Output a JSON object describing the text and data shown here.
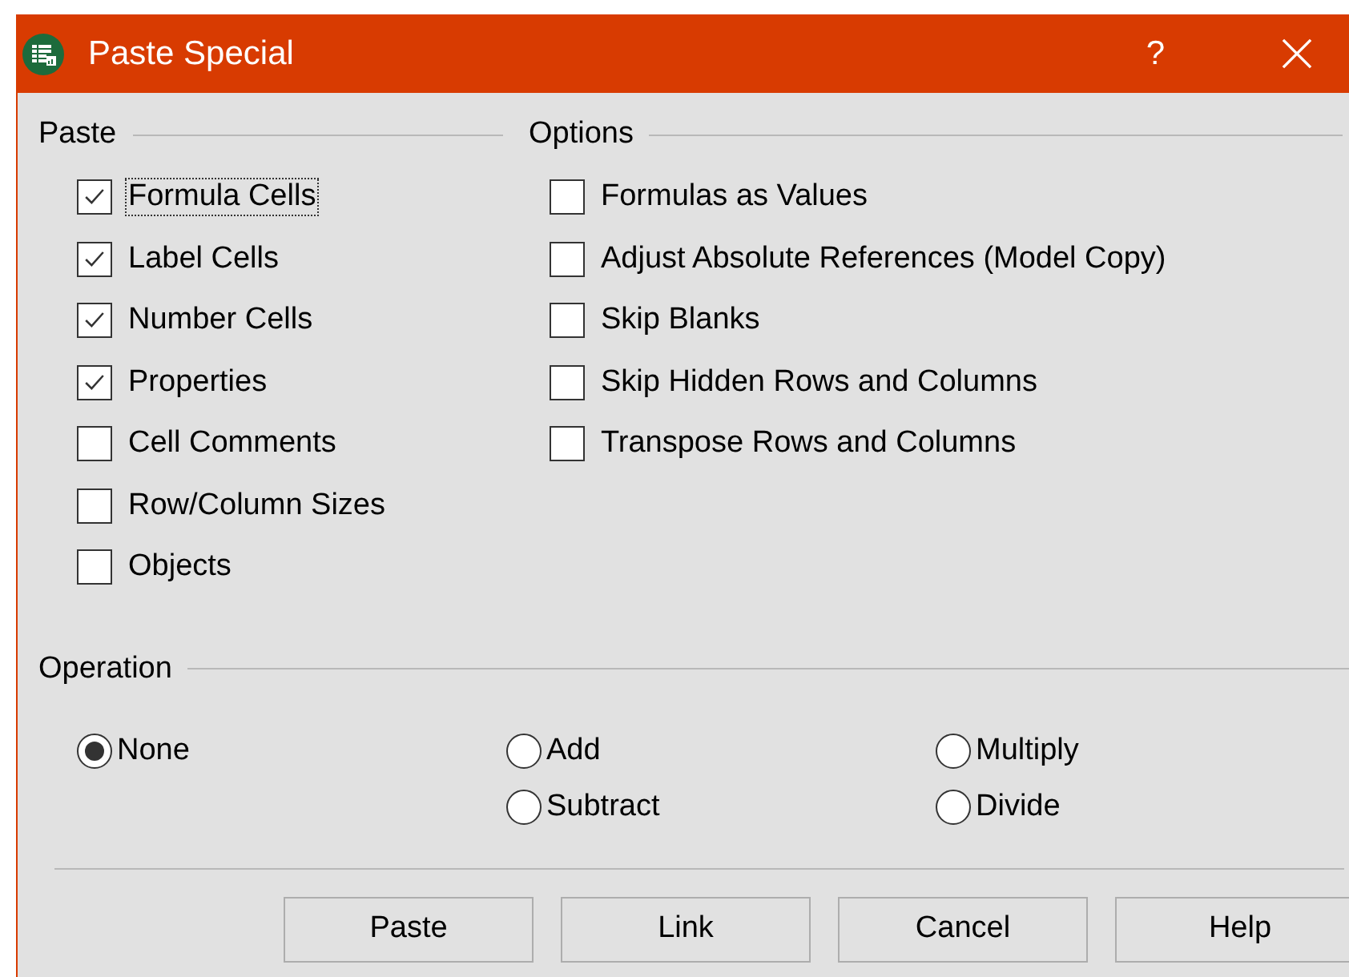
{
  "window": {
    "title": "Paste Special",
    "help": "?"
  },
  "paste": {
    "title": "Paste",
    "items": [
      {
        "label": "Formula Cells",
        "checked": true,
        "focused": true
      },
      {
        "label": "Label Cells",
        "checked": true,
        "focused": false
      },
      {
        "label": "Number Cells",
        "checked": true,
        "focused": false
      },
      {
        "label": "Properties",
        "checked": true,
        "focused": false
      },
      {
        "label": "Cell Comments",
        "checked": false,
        "focused": false
      },
      {
        "label": "Row/Column Sizes",
        "checked": false,
        "focused": false
      },
      {
        "label": "Objects",
        "checked": false,
        "focused": false
      }
    ]
  },
  "options": {
    "title": "Options",
    "items": [
      {
        "label": "Formulas as Values",
        "checked": false,
        "focused": false
      },
      {
        "label": "Adjust Absolute References (Model Copy)",
        "checked": false,
        "focused": false
      },
      {
        "label": "Skip Blanks",
        "checked": false,
        "focused": false
      },
      {
        "label": "Skip Hidden Rows and Columns",
        "checked": false,
        "focused": false
      },
      {
        "label": "Transpose Rows and Columns",
        "checked": false,
        "focused": false
      }
    ]
  },
  "operation": {
    "title": "Operation",
    "columns": [
      [
        {
          "label": "None",
          "selected": true
        }
      ],
      [
        {
          "label": "Add",
          "selected": false
        },
        {
          "label": "Subtract",
          "selected": false
        }
      ],
      [
        {
          "label": "Multiply",
          "selected": false
        },
        {
          "label": "Divide",
          "selected": false
        }
      ]
    ]
  },
  "buttons": [
    {
      "label": "Paste"
    },
    {
      "label": "Link"
    },
    {
      "label": "Cancel"
    },
    {
      "label": "Help"
    }
  ]
}
